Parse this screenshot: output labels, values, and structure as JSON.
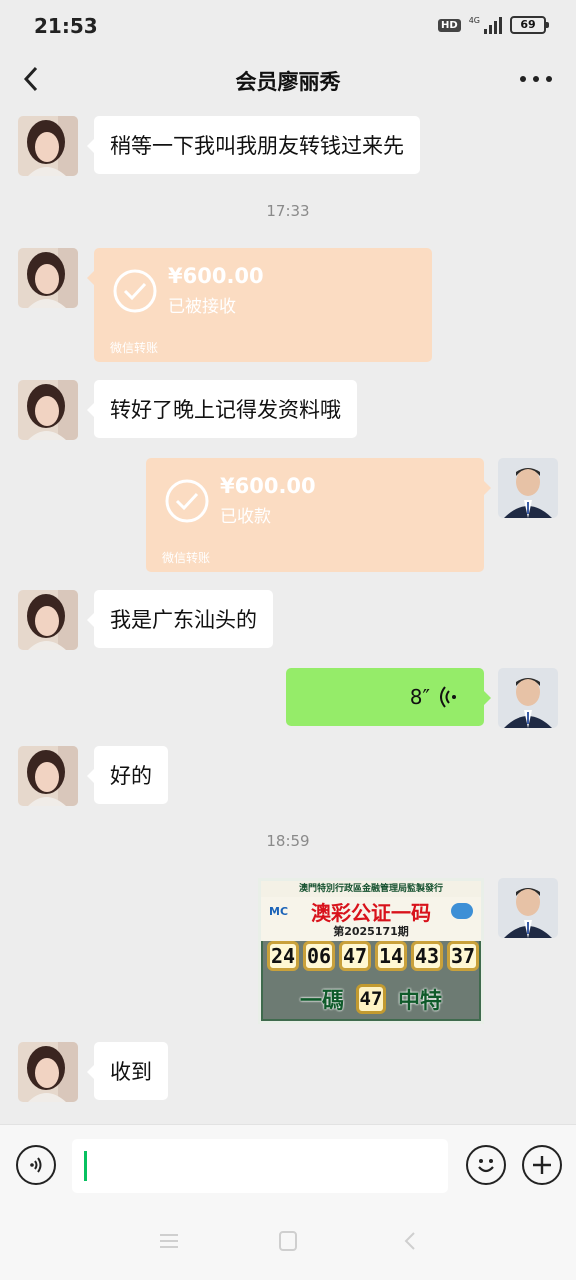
{
  "status_bar": {
    "time": "21:53",
    "hd": "HD",
    "network": "4G",
    "battery": "69"
  },
  "header": {
    "title": "会员廖丽秀"
  },
  "messages": {
    "m1": {
      "text": "稍等一下我叫我朋友转钱过来先"
    },
    "t1": {
      "time": "17:33"
    },
    "transfer1": {
      "amount": "¥600.00",
      "status": "已被接收",
      "footer": "微信转账"
    },
    "m2": {
      "text": "转好了晚上记得发资料哦"
    },
    "transfer2": {
      "amount": "¥600.00",
      "status": "已收款",
      "footer": "微信转账"
    },
    "m3": {
      "text": "我是广东汕头的"
    },
    "voice": {
      "duration": "8″"
    },
    "m4": {
      "text": "好的"
    },
    "t2": {
      "time": "18:59"
    },
    "lottery": {
      "header": "澳門特別行政區金融管理局監製發行",
      "logo": "MC",
      "title": "澳彩公证一码",
      "period": "第2025171期",
      "numbers": [
        "24",
        "06",
        "47",
        "14",
        "43",
        "37"
      ],
      "bottom_left": "一碼",
      "special": "47",
      "bottom_right": "中特"
    },
    "m5": {
      "text": "收到"
    }
  },
  "colors": {
    "sent_bubble": "#95ec69",
    "transfer_bubble": "#fbdcc2",
    "background": "#ededed",
    "caret": "#07c160"
  },
  "icons": [
    "back-icon",
    "more-icon",
    "check-icon",
    "voice-wave-icon",
    "voice-input-icon",
    "emoji-icon",
    "plus-icon",
    "menu-icon",
    "home-icon",
    "back-nav-icon"
  ]
}
